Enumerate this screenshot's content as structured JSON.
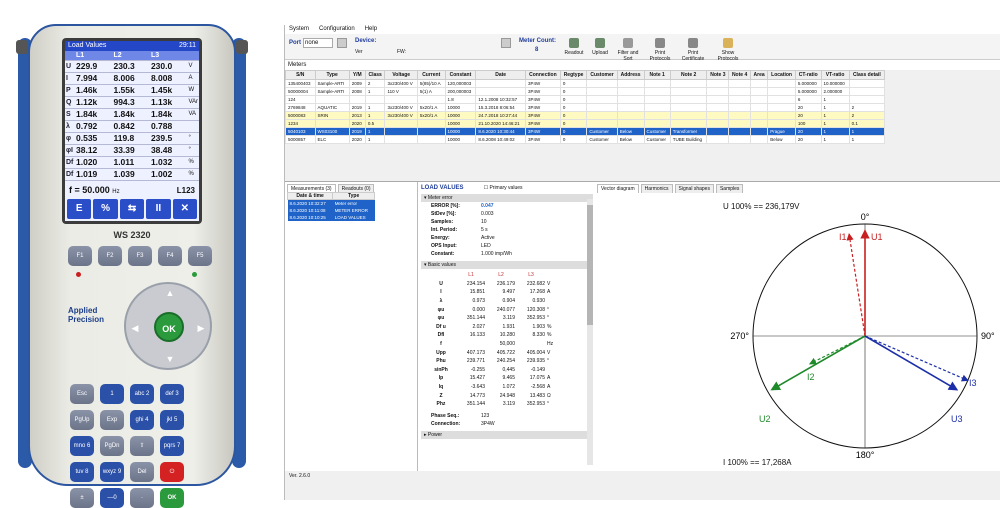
{
  "device": {
    "lcd_title": "Load Values",
    "lcd_time": "29:11",
    "lcd_header": [
      "",
      "L1",
      "L2",
      "L3",
      ""
    ],
    "lcd_rows": [
      [
        "U",
        "229.9",
        "230.3",
        "230.0",
        "V"
      ],
      [
        "I",
        "7.994",
        "8.006",
        "8.008",
        "A"
      ],
      [
        "P",
        "1.46k",
        "1.55k",
        "1.45k",
        "W"
      ],
      [
        "Q",
        "1.12k",
        "994.3",
        "1.13k",
        "VAr"
      ],
      [
        "S",
        "1.84k",
        "1.84k",
        "1.84k",
        "VA"
      ],
      [
        "λ",
        "0.792",
        "0.842",
        "0.788",
        ""
      ],
      [
        "φ",
        "0.535",
        "119.8",
        "239.5",
        "°"
      ],
      [
        "φI",
        "38.12",
        "33.39",
        "38.48",
        "°"
      ],
      [
        "Df",
        "1.020",
        "1.011",
        "1.032",
        "%"
      ],
      [
        "Df",
        "1.019",
        "1.039",
        "1.002",
        "%"
      ]
    ],
    "freq": "f = 50.000",
    "freq_unit": "Hz",
    "mode": "L123",
    "icons": [
      "E",
      "%",
      "⇆",
      "II",
      "✕"
    ],
    "model": "WS 2320",
    "fkeys": [
      "F1",
      "F2",
      "F3",
      "F4",
      "F5"
    ],
    "logo": "Applied Precision",
    "ok": "OK",
    "keys": [
      "Esc",
      "1",
      "abc 2",
      "def 3",
      "PgUp",
      "Exp",
      "ghi 4",
      "jkl 5",
      "mno 6",
      "PgDn",
      "⇧",
      "pqrs 7",
      "tuv 8",
      "wxyz 9",
      "Del",
      "⏻",
      "±",
      "—0",
      "·",
      "OK"
    ]
  },
  "app": {
    "menu": [
      "System",
      "Configuration",
      "Help"
    ],
    "port_label": "Port",
    "port_value": "none",
    "device_label": "Device:",
    "device_sub": [
      "Ver",
      "FW:"
    ],
    "meter_count_label": "Meter Count:",
    "meter_count": "8",
    "tools": [
      "Readout",
      "Upload",
      "Filter and Sort",
      "Print Protocols",
      "Print Certificate",
      "Show Protocols"
    ],
    "meters_title": "Meters",
    "meter_cols": [
      "S/N",
      "Type",
      "Y/M",
      "Class",
      "Voltage",
      "Current",
      "Constant",
      "Date",
      "Connection",
      "Regtype",
      "Customer",
      "Address",
      "Note 1",
      "Note 2",
      "Note 3",
      "Note 4",
      "Area",
      "Location",
      "CT-ratio",
      "VT-ratio",
      "Class detail"
    ],
    "meter_rows": [
      [
        "135400403",
        "Sample-ARTI",
        "2009",
        "2",
        "3x230/400 V",
        "5(85)/10 A",
        "120,000003",
        "",
        "3P4W",
        "0",
        "",
        "",
        "",
        "",
        "",
        "",
        "",
        "",
        "5.000000",
        "10.000000",
        ""
      ],
      [
        "50000004",
        "Sample-ARTI",
        "2008",
        "1",
        "110 V",
        "5(1) A",
        "200,000003",
        "",
        "3P4W",
        "0",
        "",
        "",
        "",
        "",
        "",
        "",
        "",
        "",
        "5.000000",
        "2.000000",
        ""
      ],
      [
        "124",
        "",
        "",
        "",
        "",
        "",
        "1.8",
        "12.1.2008 10:32:57",
        "3P4W",
        "0",
        "",
        "",
        "",
        "",
        "",
        "",
        "",
        "",
        "6",
        "1",
        ""
      ],
      [
        "2769848",
        "AQUATIC",
        "2019",
        "1",
        "3x230/400 V",
        "5x20/1 A",
        "10000",
        "15.3.2018 8:06:54",
        "3P4W",
        "0",
        "",
        "",
        "",
        "",
        "",
        "",
        "",
        "",
        "20",
        "1",
        "2"
      ],
      [
        "5000083",
        "SRIN",
        "2013",
        "1",
        "3x230/400 V",
        "5x20/1 A",
        "10000",
        "24.7.2018 10:27:44",
        "3P4W",
        "0",
        "",
        "",
        "",
        "",
        "",
        "",
        "",
        "",
        "20",
        "1",
        "2"
      ],
      [
        "1234",
        "",
        "2020",
        "0.5",
        "",
        "",
        "10000",
        "21.10.2020 14:46:21",
        "3P4W",
        "0",
        "",
        "",
        "",
        "",
        "",
        "",
        "",
        "",
        "100",
        "1",
        "0.1"
      ],
      [
        "5040103",
        "WS03100",
        "2019",
        "1",
        "",
        "",
        "10000",
        "8.6.2020 10:30:44",
        "3P4W",
        "0",
        "Customer",
        "Below",
        "Customer",
        "Transformer",
        "",
        "",
        "",
        "Prague",
        "20",
        "1",
        "1"
      ],
      [
        "5000857",
        "ELC",
        "2020",
        "1",
        "",
        "",
        "10000",
        "8.6.2008 10:49:02",
        "3P4W",
        "0",
        "Customer",
        "Below",
        "Customer",
        "TUBE Building",
        "",
        "",
        "",
        "Below",
        "20",
        "1",
        "1"
      ]
    ],
    "left_tabs": [
      "Measurements (3)",
      "Readouts (0)"
    ],
    "read_cols": [
      "Date & time",
      "Type"
    ],
    "read_rows": [
      [
        "8.6.2020 10:32:27",
        "Meter error"
      ],
      [
        "8.6.2020 10:11:08",
        "METER ERROR"
      ],
      [
        "8.6.2020 10:10:25",
        "LOAD VALUES"
      ]
    ],
    "load_title": "LOAD VALUES",
    "primary_values": "Primary values",
    "meter_error_header": "Meter error",
    "meter_error": [
      [
        "ERROR [%]:",
        "0.047"
      ],
      [
        "StDev [%]:",
        "0.003"
      ],
      [
        "Samples:",
        "10"
      ],
      [
        "Int. Period:",
        "5 s"
      ],
      [
        "Energy:",
        "Active"
      ],
      [
        "OPS Input:",
        "LED"
      ],
      [
        "Constant:",
        "1.000 imp/Wh"
      ]
    ],
    "basic_header": "Basic values",
    "basic_cols": [
      "",
      "L1",
      "L2",
      "L3",
      ""
    ],
    "basic_rows": [
      [
        "U",
        "234.154",
        "236.179",
        "232.682",
        "V"
      ],
      [
        "I",
        "15.851",
        "9.497",
        "17.268",
        "A"
      ],
      [
        "λ",
        "0.973",
        "0.904",
        "0.930",
        ""
      ],
      [
        "φu",
        "0.000",
        "240.077",
        "120.308",
        "°"
      ],
      [
        "φu",
        "351.144",
        "3.119",
        "352.953",
        "°"
      ],
      [
        "Df u",
        "2.027",
        "1.931",
        "1.903",
        "%"
      ],
      [
        "DfI",
        "16.133",
        "10.280",
        "8.330",
        "%"
      ],
      [
        "f",
        "",
        "50,000",
        "",
        "Hz"
      ],
      [
        "Upp",
        "407.173",
        "405.722",
        "405.004",
        "V"
      ],
      [
        "Phu",
        "239.771",
        "240.254",
        "239.935",
        "°"
      ],
      [
        "sinPh",
        "-0.255",
        "0,445",
        "-0.149",
        ""
      ],
      [
        "Ip",
        "15.427",
        "9.465",
        "17.075",
        "A"
      ],
      [
        "Iq",
        "-3.643",
        "1.072",
        "-2.568",
        "A"
      ],
      [
        "Z",
        "14.773",
        "24.948",
        "13.483",
        "Ω"
      ],
      [
        "Phz",
        "351.144",
        "3.119",
        "352.953",
        "°"
      ]
    ],
    "phase_seq_label": "Phase Seq.:",
    "phase_seq": "123",
    "connection_label": "Connection:",
    "connection": "3P4W",
    "power_header": "Power",
    "right_tabs": [
      "Vector diagram",
      "Harmonics",
      "Signal shapes",
      "Samples"
    ],
    "vector_u": "U 100% == 236,179V",
    "vector_i": "I 100% == 17,268A",
    "angles": [
      "0°",
      "90°",
      "180°",
      "270°"
    ],
    "phasors": [
      "U1",
      "U2",
      "U3",
      "I1",
      "I2",
      "I3"
    ],
    "status": "Ver. 2.6.0"
  },
  "colors": {
    "u1": "#c82020",
    "u2": "#1f8a2a",
    "u3": "#1c2fa8",
    "accent": "#1f63c8"
  }
}
